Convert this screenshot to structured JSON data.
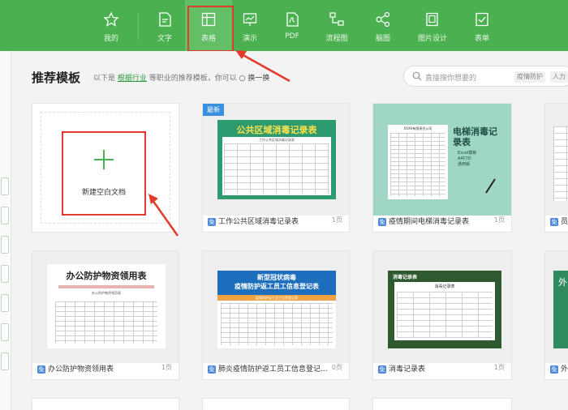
{
  "toolbar": {
    "items": [
      {
        "label": "我的",
        "icon": "star-icon"
      },
      {
        "label": "文字",
        "icon": "document-icon"
      },
      {
        "label": "表格",
        "icon": "table-icon"
      },
      {
        "label": "演示",
        "icon": "presentation-icon"
      },
      {
        "label": "PDF",
        "icon": "pdf-icon"
      },
      {
        "label": "流程图",
        "icon": "flowchart-icon"
      },
      {
        "label": "脑图",
        "icon": "mindmap-icon"
      },
      {
        "label": "图片设计",
        "icon": "image-design-icon"
      },
      {
        "label": "表单",
        "icon": "form-icon"
      }
    ],
    "active": "表格",
    "accent_color": "#4bb04f",
    "highlight_color": "#e23a2b"
  },
  "section": {
    "title": "推荐模板",
    "hint_prefix": "以下是",
    "hint_link": "根据行业",
    "hint_suffix": "等职业的推荐模板，你可以",
    "swap_label": "换一换"
  },
  "search": {
    "placeholder": "直接搜你想要的",
    "chips": [
      "疫情防护",
      "人力"
    ]
  },
  "new_doc": {
    "label": "新建空白文档"
  },
  "templates": [
    {
      "title": "工作公共区域消毒记录表",
      "pages": "1页",
      "badge": "最新",
      "thumb_heading": "公共区域消毒记录表",
      "thumb_sub": "工作公共区域消毒记录表"
    },
    {
      "title": "疫情期间电梯消毒记录表",
      "pages": "1页",
      "thumb_heading": "电梯消毒记录表",
      "thumb_company": "XXXX有限责任公司",
      "thumb_bullets": [
        "Excel模板",
        "A4打印",
        "通用版"
      ]
    },
    {
      "title": "员工",
      "pages": ""
    },
    {
      "title": "办公防护物资领用表",
      "pages": "1页",
      "thumb_heading": "办公防护物资领用表",
      "thumb_sub": "办公防护物资领用表"
    },
    {
      "title": "肺炎疫情防护返工员工信息登记...",
      "pages": "0页",
      "thumb_heading_1": "新型冠状病毒",
      "thumb_heading_2": "疫情防护返工员工信息登记表",
      "thumb_sub": "疫情防护返工员工信息登记表"
    },
    {
      "title": "消毒记录表",
      "pages": "1页",
      "thumb_heading": "消毒记录表",
      "thumb_sub": "消毒记录表"
    },
    {
      "title": "外",
      "pages": "",
      "thumb_heading": "外"
    }
  ],
  "free_badge": "免"
}
